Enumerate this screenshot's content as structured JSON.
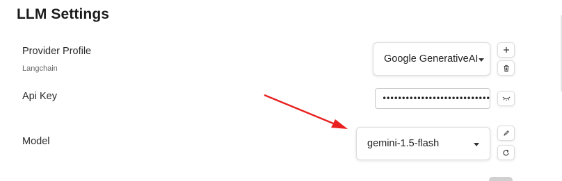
{
  "page": {
    "title": "LLM Settings"
  },
  "provider_profile": {
    "label": "Provider Profile",
    "sublabel": "Langchain",
    "selected": "Google GenerativeAI"
  },
  "api_key": {
    "label": "Api Key",
    "masked_value": "••••••••••••••••••••••••••••••••••"
  },
  "model": {
    "label": "Model",
    "selected": "gemini-1.5-flash"
  },
  "icons": {
    "add": "plus-icon",
    "delete": "trash-icon",
    "toggle_visibility": "eye-closed-icon",
    "edit": "pencil-icon",
    "refresh": "refresh-icon"
  },
  "colors": {
    "annotation_arrow": "#e8201f"
  }
}
